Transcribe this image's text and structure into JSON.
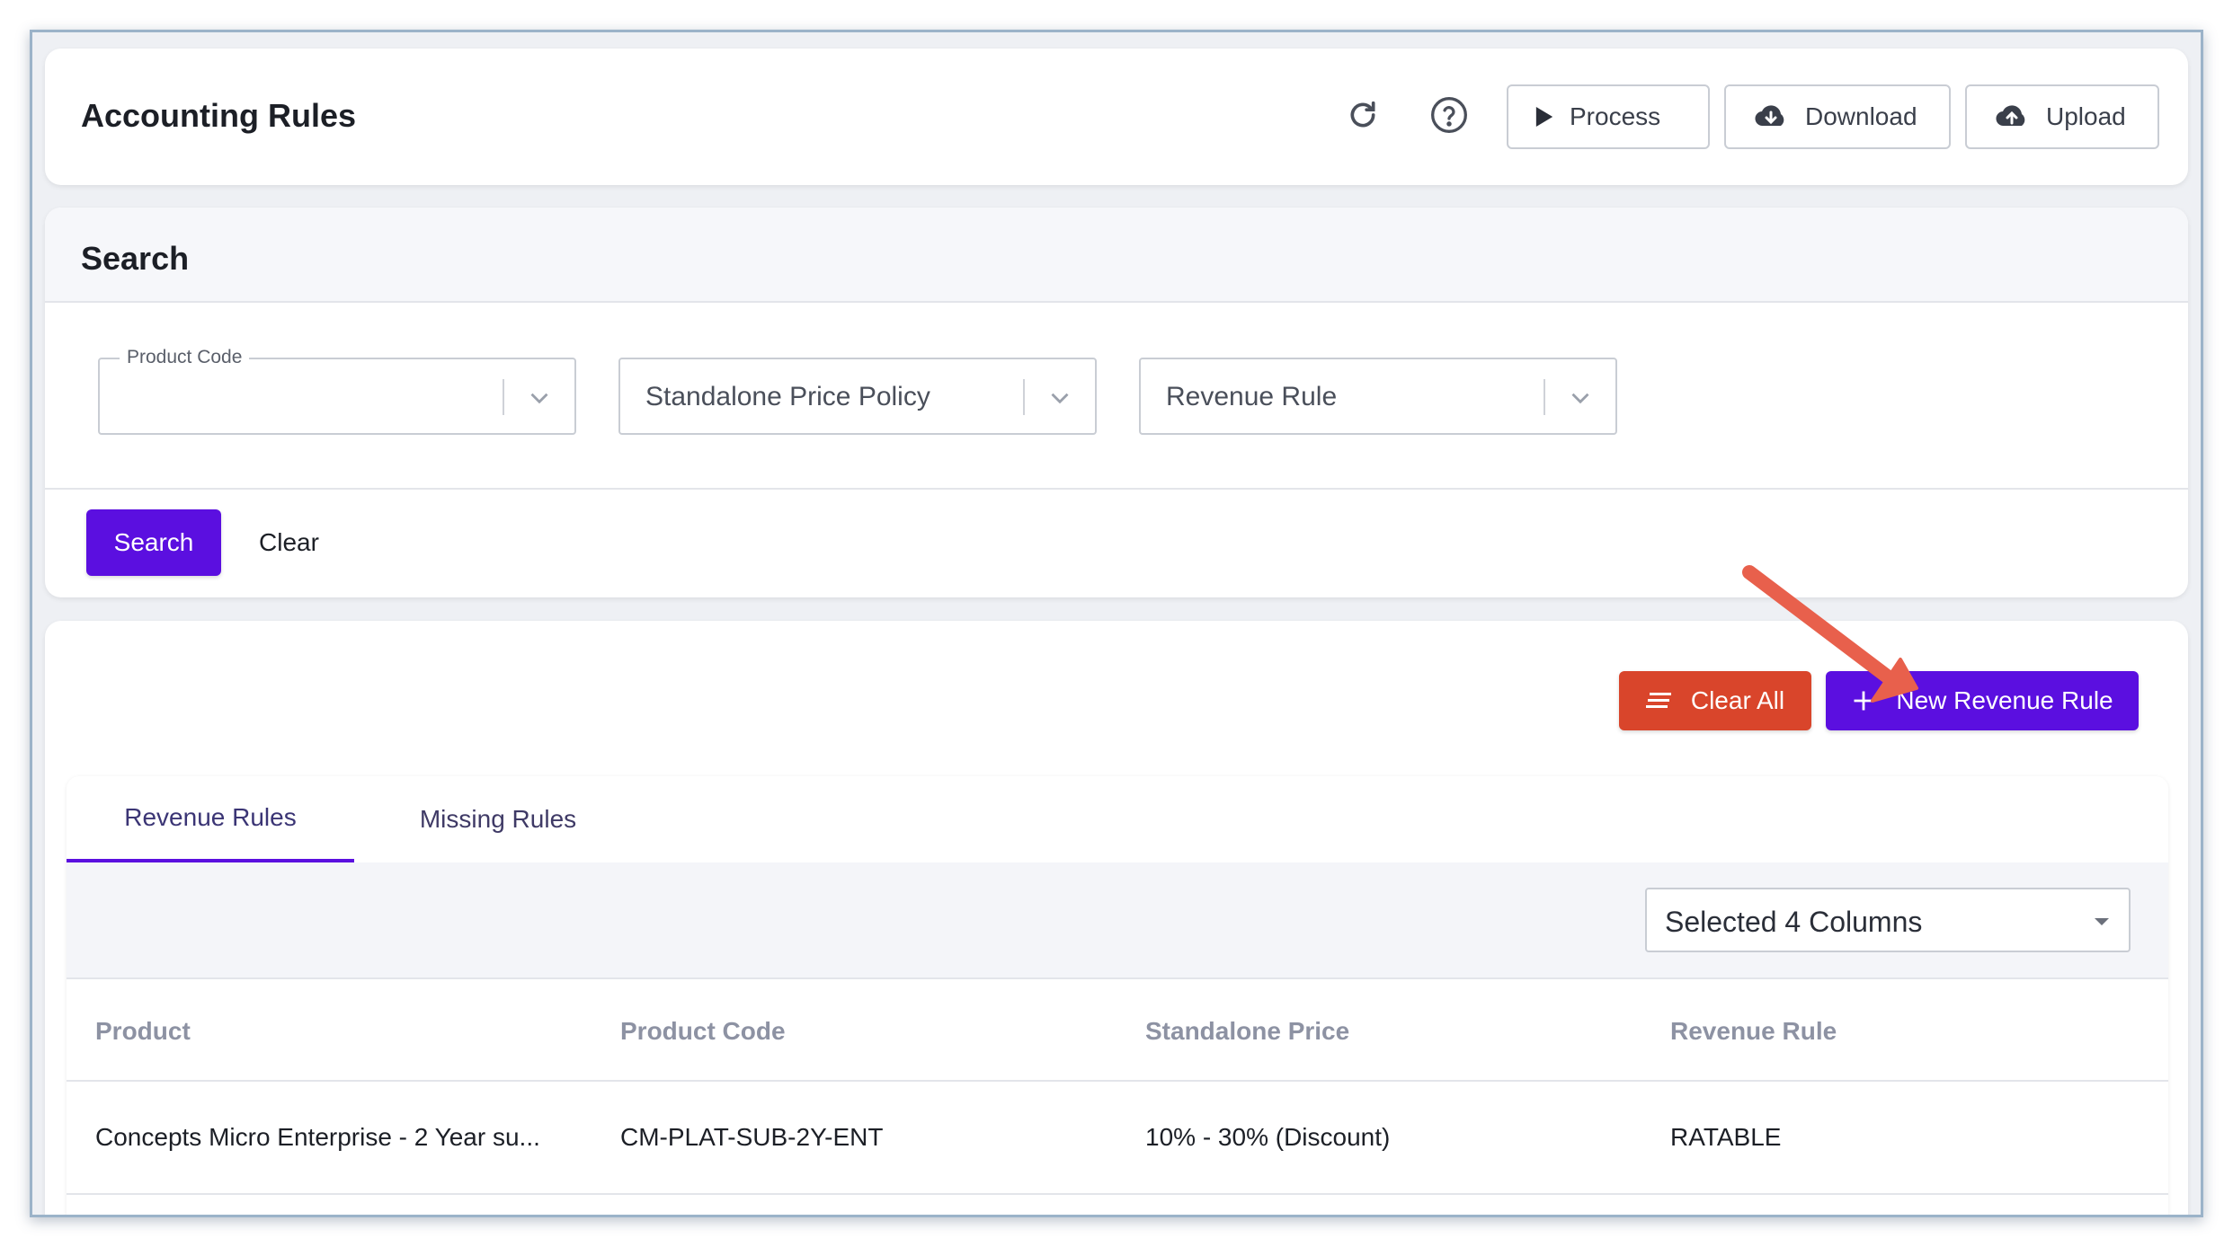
{
  "header": {
    "title": "Accounting Rules",
    "refresh_icon": "refresh-icon",
    "help_icon": "help-icon",
    "buttons": {
      "process": "Process",
      "download": "Download",
      "upload": "Upload"
    }
  },
  "search": {
    "title": "Search",
    "filters": {
      "product_code": {
        "label": "Product Code",
        "value": ""
      },
      "standalone_price_policy": {
        "placeholder": "Standalone Price Policy"
      },
      "revenue_rule": {
        "placeholder": "Revenue Rule"
      }
    },
    "search_button": "Search",
    "clear_button": "Clear"
  },
  "actions": {
    "clear_all": "Clear All",
    "new_revenue_rule": "New Revenue Rule"
  },
  "tabs": [
    {
      "label": "Revenue Rules",
      "active": true
    },
    {
      "label": "Missing Rules",
      "active": false
    }
  ],
  "column_selector": {
    "value": "Selected 4 Columns"
  },
  "table": {
    "columns": [
      "Product",
      "Product Code",
      "Standalone Price",
      "Revenue Rule"
    ],
    "rows": [
      [
        "Concepts Micro Enterprise - 2 Year su...",
        "CM-PLAT-SUB-2Y-ENT",
        "10% - 30% (Discount)",
        "RATABLE"
      ]
    ]
  },
  "colors": {
    "primary": "#5b0fe0",
    "danger": "#d9452b",
    "annotation_arrow": "#e8604c"
  }
}
